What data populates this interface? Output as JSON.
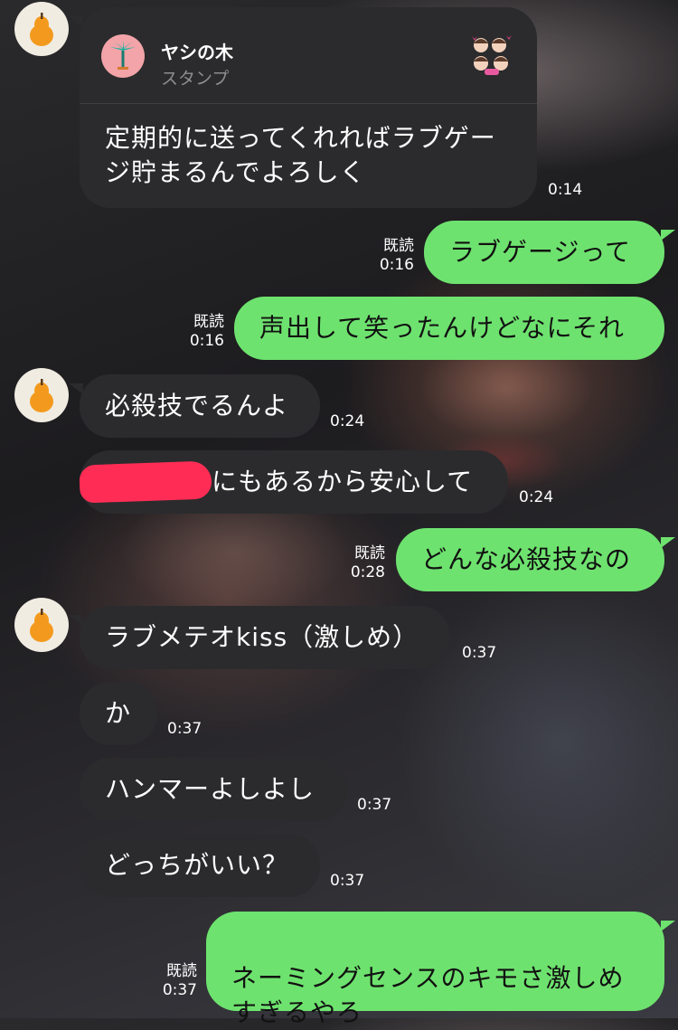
{
  "stamp": {
    "name": "ヤシの木",
    "kind": "スタンプ",
    "text": "定期的に送ってくれればラブゲー\nジ貯まるんでよろしく",
    "time": "0:14"
  },
  "messages": [
    {
      "id": "m1",
      "side": "out",
      "text": "ラブゲージって",
      "read": "既読",
      "time": "0:16"
    },
    {
      "id": "m2",
      "side": "out",
      "text": "声出して笑ったんけどなにそれ",
      "read": "既読",
      "time": "0:16"
    },
    {
      "id": "m3",
      "side": "in",
      "text": "必殺技でるんよ",
      "time": "0:24"
    },
    {
      "id": "m4",
      "side": "in",
      "text": "にもあるから安心して",
      "time": "0:24"
    },
    {
      "id": "m5",
      "side": "out",
      "text": "どんな必殺技なの",
      "read": "既読",
      "time": "0:28"
    },
    {
      "id": "m6",
      "side": "in",
      "text": "ラブメテオkiss（激しめ）",
      "time": "0:37"
    },
    {
      "id": "m7",
      "side": "in",
      "text": "か",
      "time": "0:37"
    },
    {
      "id": "m8",
      "side": "in",
      "text": "ハンマーよしよし",
      "time": "0:37"
    },
    {
      "id": "m9",
      "side": "in",
      "text": "どっちがいい？",
      "time": "0:37"
    },
    {
      "id": "m10",
      "side": "out",
      "text": "ネーミングセンスのキモさ激しめ\nすぎるやろ",
      "read": "既読",
      "time": "0:37"
    }
  ],
  "icons": {
    "avatar": "pear-avatar-icon",
    "stamp": "palm-tree-icon",
    "thumb": "sticker-thumbnail-icon"
  },
  "colors": {
    "incoming_bubble": "#2b2b2d",
    "outgoing_bubble": "#6ee26f",
    "avatar_fruit": "#f39a1e",
    "redaction": "#ff2d55"
  }
}
